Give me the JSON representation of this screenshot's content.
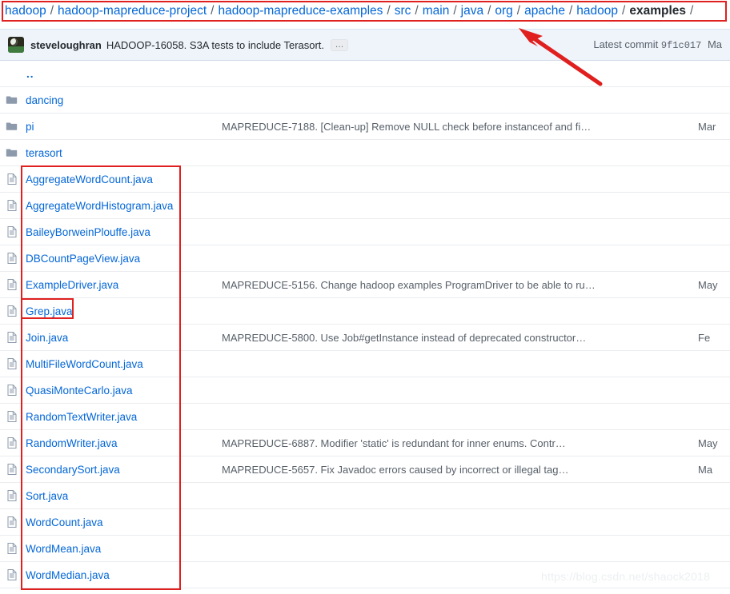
{
  "breadcrumb": {
    "separator": "/",
    "parts": [
      {
        "label": "hadoop",
        "current": false
      },
      {
        "label": "hadoop-mapreduce-project",
        "current": false
      },
      {
        "label": "hadoop-mapreduce-examples",
        "current": false
      },
      {
        "label": "src",
        "current": false
      },
      {
        "label": "main",
        "current": false
      },
      {
        "label": "java",
        "current": false
      },
      {
        "label": "org",
        "current": false
      },
      {
        "label": "apache",
        "current": false
      },
      {
        "label": "hadoop",
        "current": false
      },
      {
        "label": "examples",
        "current": true
      }
    ],
    "trailing_separator": "/"
  },
  "commit_header": {
    "avatar_name": "user-avatar",
    "author": "steveloughran",
    "message": "HADOOP-16058. S3A tests to include Terasort.",
    "expand_label": "…",
    "latest_commit_label": "Latest commit",
    "sha": "9f1c017",
    "date": "Ma"
  },
  "file_table": {
    "up_directory": "..",
    "rows": [
      {
        "icon": "folder-icon",
        "name": "dancing",
        "message": "",
        "age": ""
      },
      {
        "icon": "folder-icon",
        "name": "pi",
        "message": "MAPREDUCE-7188. [Clean-up] Remove NULL check before instanceof and fi…",
        "age": "Mar"
      },
      {
        "icon": "folder-icon",
        "name": "terasort",
        "message": "",
        "age": ""
      },
      {
        "icon": "file-icon",
        "name": "AggregateWordCount.java",
        "message": "",
        "age": ""
      },
      {
        "icon": "file-icon",
        "name": "AggregateWordHistogram.java",
        "message": "",
        "age": ""
      },
      {
        "icon": "file-icon",
        "name": "BaileyBorweinPlouffe.java",
        "message": "",
        "age": ""
      },
      {
        "icon": "file-icon",
        "name": "DBCountPageView.java",
        "message": "",
        "age": ""
      },
      {
        "icon": "file-icon",
        "name": "ExampleDriver.java",
        "message": "MAPREDUCE-5156. Change hadoop examples ProgramDriver to be able to ru…",
        "age": "May"
      },
      {
        "icon": "file-icon",
        "name": "Grep.java",
        "message": "",
        "age": ""
      },
      {
        "icon": "file-icon",
        "name": "Join.java",
        "message": "MAPREDUCE-5800. Use Job#getInstance instead of deprecated constructor…",
        "age": "Fe"
      },
      {
        "icon": "file-icon",
        "name": "MultiFileWordCount.java",
        "message": "",
        "age": ""
      },
      {
        "icon": "file-icon",
        "name": "QuasiMonteCarlo.java",
        "message": "",
        "age": ""
      },
      {
        "icon": "file-icon",
        "name": "RandomTextWriter.java",
        "message": "",
        "age": ""
      },
      {
        "icon": "file-icon",
        "name": "RandomWriter.java",
        "message": "MAPREDUCE-6887. Modifier 'static' is redundant for inner enums. Contr…",
        "age": "May"
      },
      {
        "icon": "file-icon",
        "name": "SecondarySort.java",
        "message": "MAPREDUCE-5657. Fix Javadoc errors caused by incorrect or illegal tag…",
        "age": "Ma"
      },
      {
        "icon": "file-icon",
        "name": "Sort.java",
        "message": "",
        "age": ""
      },
      {
        "icon": "file-icon",
        "name": "WordCount.java",
        "message": "",
        "age": ""
      },
      {
        "icon": "file-icon",
        "name": "WordMean.java",
        "message": "",
        "age": ""
      },
      {
        "icon": "file-icon",
        "name": "WordMedian.java",
        "message": "",
        "age": ""
      }
    ]
  },
  "annotations": {
    "color": "#e01f1f",
    "breadcrumb_box": "breadcrumb-highlight",
    "files_box": "file-list-highlight",
    "grep_box": "grep-file-highlight",
    "arrow": "pointer-arrow"
  },
  "watermark": {
    "text": "https://blog.csdn.net/shaock2018"
  },
  "colors": {
    "link": "#0366d6",
    "muted": "#586069",
    "header_band": "#eff4fb",
    "row_border": "#eaecef",
    "annotation_red": "#e01f1f"
  }
}
